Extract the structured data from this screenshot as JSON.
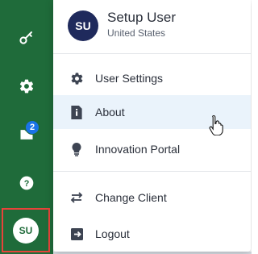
{
  "sidebar": {
    "items": [
      {
        "icon": "key-icon"
      },
      {
        "icon": "gear-icon"
      },
      {
        "icon": "folder-icon",
        "badge": "2"
      },
      {
        "icon": "help-icon"
      }
    ],
    "avatar_initials": "SU"
  },
  "user_menu": {
    "avatar_initials": "SU",
    "user_name": "Setup User",
    "user_country": "United States",
    "items": [
      {
        "label": "User Settings",
        "icon": "gear-icon"
      },
      {
        "label": "About",
        "icon": "info-icon",
        "hovered": true
      },
      {
        "label": "Innovation Portal",
        "icon": "lightbulb-icon"
      },
      {
        "label": "Change Client",
        "icon": "swap-arrows-icon"
      },
      {
        "label": "Logout",
        "icon": "logout-icon"
      }
    ]
  },
  "colors": {
    "sidebar_bg": "#1f6b3a",
    "avatar_bg": "#1f2a5c",
    "badge_bg": "#1a73e8",
    "hover_bg": "#eaf3fb",
    "highlight_border": "#e8433a"
  }
}
